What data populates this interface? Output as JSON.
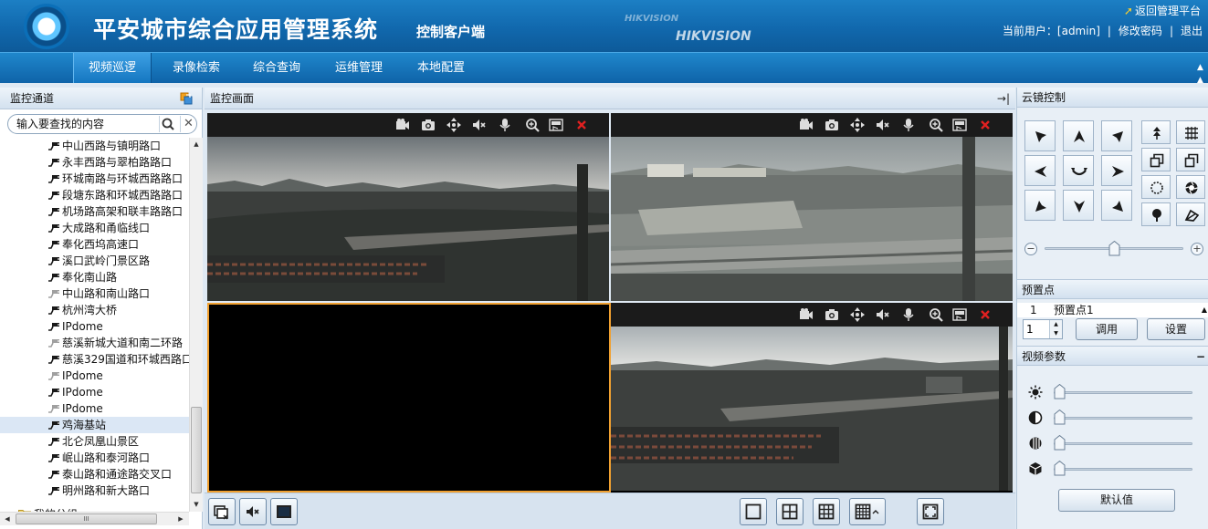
{
  "header": {
    "title": "平安城市综合应用管理系统",
    "subtitle": "控制客户端",
    "brand_faint": "HIKVISION",
    "brand": "HIKVISION",
    "return_link": "返回管理平台",
    "current_user_label": "当前用户：[admin]",
    "sep": "|",
    "change_password": "修改密码",
    "logout": "退出"
  },
  "menu": {
    "items": [
      "视频巡逻",
      "录像检索",
      "综合查询",
      "运维管理",
      "本地配置"
    ],
    "active": "视频巡逻"
  },
  "left_panel": {
    "title": "监控通道",
    "search_placeholder": "输入要查找的内容",
    "tree": [
      {
        "label": "中山西路与镇明路口",
        "state": "online"
      },
      {
        "label": "永丰西路与翠柏路路口",
        "state": "online"
      },
      {
        "label": "环城南路与环城西路路口",
        "state": "online"
      },
      {
        "label": "段塘东路和环城西路路口",
        "state": "online"
      },
      {
        "label": "机场路高架和联丰路路口",
        "state": "online"
      },
      {
        "label": "大成路和甬临线口",
        "state": "online"
      },
      {
        "label": "奉化西坞高速口",
        "state": "online"
      },
      {
        "label": "溪口武岭门景区路",
        "state": "online"
      },
      {
        "label": "奉化南山路",
        "state": "online"
      },
      {
        "label": "中山路和南山路口",
        "state": "offline"
      },
      {
        "label": "杭州湾大桥",
        "state": "online"
      },
      {
        "label": "IPdome",
        "state": "online"
      },
      {
        "label": "慈溪新城大道和南二环路",
        "state": "offline"
      },
      {
        "label": "慈溪329国道和环城西路口",
        "state": "online"
      },
      {
        "label": "IPdome",
        "state": "offline"
      },
      {
        "label": "IPdome",
        "state": "online"
      },
      {
        "label": "IPdome",
        "state": "offline"
      },
      {
        "label": "鸡海基站",
        "state": "online",
        "selected": true
      },
      {
        "label": "北仑凤凰山景区",
        "state": "online"
      },
      {
        "label": "岷山路和泰河路口",
        "state": "online"
      },
      {
        "label": "泰山路和通途路交叉口",
        "state": "online"
      },
      {
        "label": "明州路和新大路口",
        "state": "online"
      }
    ],
    "group_label": "我的分组",
    "hscroll_grip": "III"
  },
  "center": {
    "title": "监控画面",
    "collapse_icon": "→|"
  },
  "right_panel": {
    "ptz_title": "云镜控制",
    "preset_title": "预置点",
    "preset_row": {
      "index": "1",
      "name": "预置点1"
    },
    "preset_value": "1",
    "call_btn": "调用",
    "set_btn": "设置",
    "video_params_title": "视频参数",
    "video_params_collapse": "−",
    "default_btn": "默认值",
    "zoom_level": 0.5,
    "brightness": 0.0,
    "contrast": 0.0,
    "saturation": 0.0,
    "hue": 0.0
  },
  "colors": {
    "header": "#1168ad",
    "close_red": "#e02020",
    "active_pane": "#f0a030"
  }
}
